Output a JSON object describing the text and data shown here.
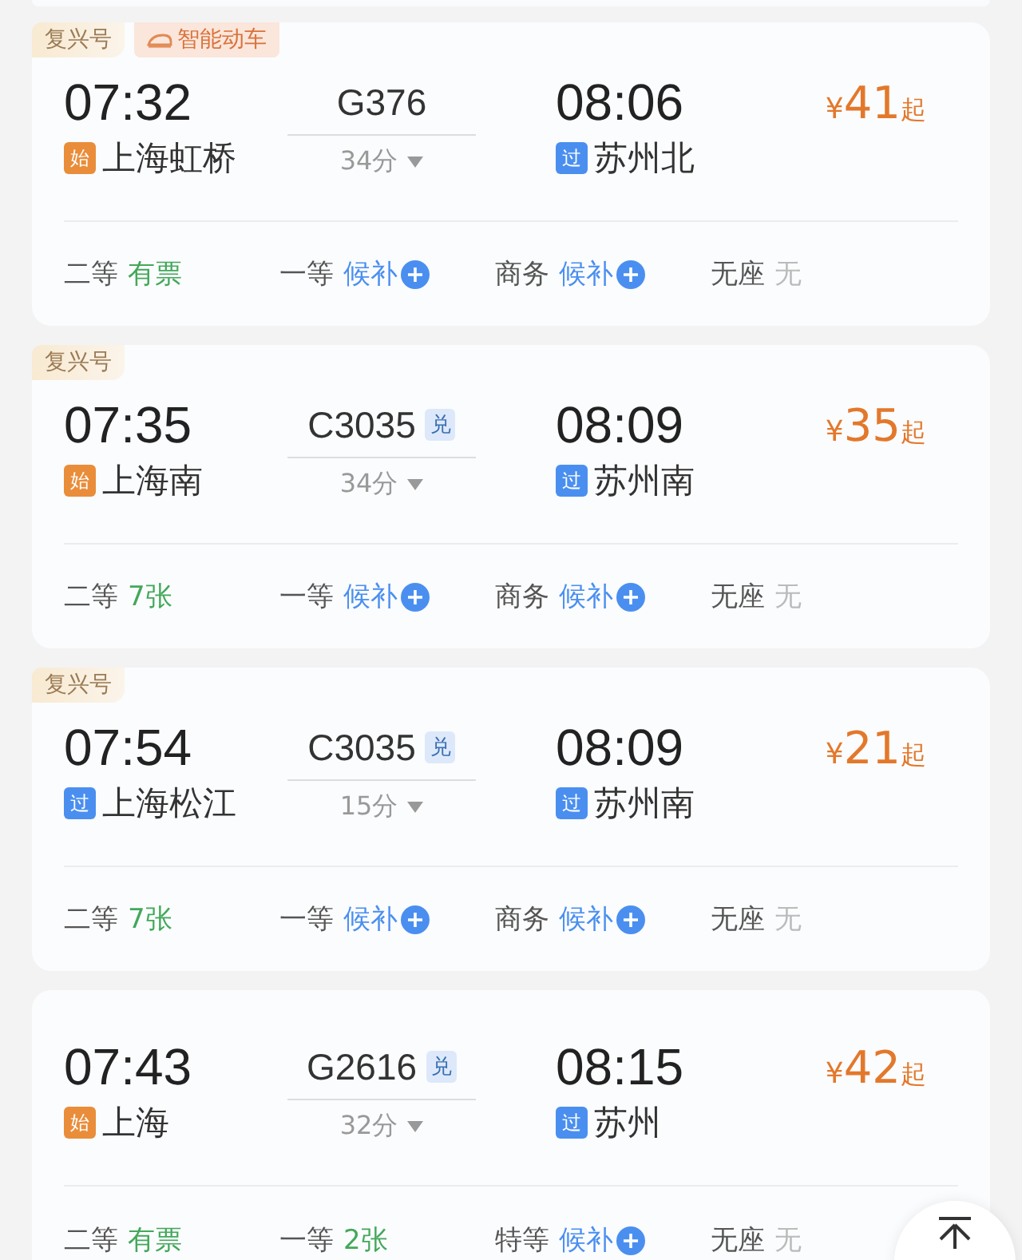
{
  "trains": [
    {
      "tags": [
        {
          "kind": "fuxing",
          "label": "复兴号"
        },
        {
          "kind": "smart",
          "label": "智能动车"
        }
      ],
      "depart_time": "07:32",
      "train_no": "G376",
      "duration": "34分",
      "arrive_time": "08:06",
      "from": {
        "kind": "origin",
        "badge": "始",
        "name": "上海虹桥"
      },
      "to": {
        "kind": "pass",
        "badge": "过",
        "name": "苏州北"
      },
      "price": {
        "currency": "¥",
        "amount": "41",
        "suffix": "起"
      },
      "seats": [
        {
          "class": "二等",
          "kind": "available",
          "status": "有票"
        },
        {
          "class": "一等",
          "kind": "waitlist",
          "status": "候补"
        },
        {
          "class": "商务",
          "kind": "waitlist",
          "status": "候补"
        },
        {
          "class": "无座",
          "kind": "none",
          "status": "无"
        }
      ]
    },
    {
      "tags": [
        {
          "kind": "fuxing",
          "label": "复兴号"
        }
      ],
      "depart_time": "07:35",
      "train_no": "C3035",
      "exchange_badge": "兑",
      "duration": "34分",
      "arrive_time": "08:09",
      "from": {
        "kind": "origin",
        "badge": "始",
        "name": "上海南"
      },
      "to": {
        "kind": "pass",
        "badge": "过",
        "name": "苏州南"
      },
      "price": {
        "currency": "¥",
        "amount": "35",
        "suffix": "起"
      },
      "seats": [
        {
          "class": "二等",
          "kind": "available",
          "status": "7张"
        },
        {
          "class": "一等",
          "kind": "waitlist",
          "status": "候补"
        },
        {
          "class": "商务",
          "kind": "waitlist",
          "status": "候补"
        },
        {
          "class": "无座",
          "kind": "none",
          "status": "无"
        }
      ]
    },
    {
      "tags": [
        {
          "kind": "fuxing",
          "label": "复兴号"
        }
      ],
      "depart_time": "07:54",
      "train_no": "C3035",
      "exchange_badge": "兑",
      "duration": "15分",
      "arrive_time": "08:09",
      "from": {
        "kind": "pass",
        "badge": "过",
        "name": "上海松江"
      },
      "to": {
        "kind": "pass",
        "badge": "过",
        "name": "苏州南"
      },
      "price": {
        "currency": "¥",
        "amount": "21",
        "suffix": "起"
      },
      "seats": [
        {
          "class": "二等",
          "kind": "available",
          "status": "7张"
        },
        {
          "class": "一等",
          "kind": "waitlist",
          "status": "候补"
        },
        {
          "class": "商务",
          "kind": "waitlist",
          "status": "候补"
        },
        {
          "class": "无座",
          "kind": "none",
          "status": "无"
        }
      ]
    },
    {
      "depart_time": "07:43",
      "train_no": "G2616",
      "exchange_badge": "兑",
      "duration": "32分",
      "arrive_time": "08:15",
      "from": {
        "kind": "origin",
        "badge": "始",
        "name": "上海"
      },
      "to": {
        "kind": "pass",
        "badge": "过",
        "name": "苏州"
      },
      "price": {
        "currency": "¥",
        "amount": "42",
        "suffix": "起"
      },
      "seats": [
        {
          "class": "二等",
          "kind": "available",
          "status": "有票"
        },
        {
          "class": "一等",
          "kind": "available",
          "status": "2张"
        },
        {
          "class": "特等",
          "kind": "waitlist",
          "status": "候补"
        },
        {
          "class": "无座",
          "kind": "none",
          "status": "无"
        }
      ]
    }
  ]
}
